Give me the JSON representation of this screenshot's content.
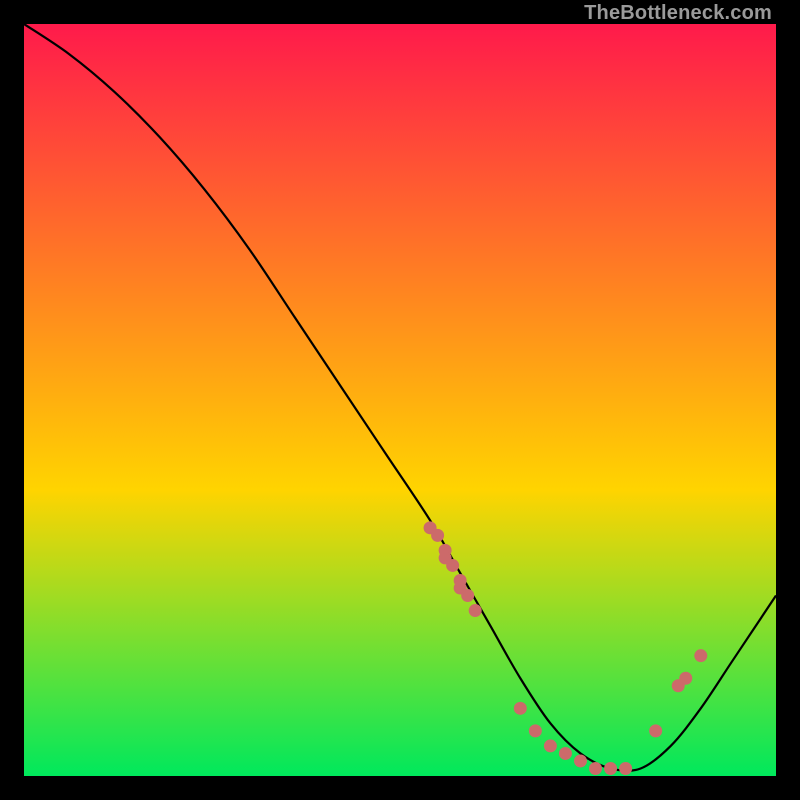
{
  "watermark": "TheBottleneck.com",
  "chart_data": {
    "type": "line",
    "title": "",
    "xlabel": "",
    "ylabel": "",
    "xlim": [
      0,
      100
    ],
    "ylim": [
      0,
      100
    ],
    "grid": false,
    "legend": false,
    "background_gradient": {
      "top": "#ff1a4b",
      "mid": "#ffd400",
      "bottom": "#00e85c"
    },
    "series": [
      {
        "name": "bottleneck-curve",
        "color": "#000000",
        "x": [
          0,
          6,
          12,
          18,
          24,
          30,
          36,
          42,
          48,
          54,
          58,
          62,
          66,
          70,
          74,
          78,
          82,
          86,
          90,
          94,
          98,
          100
        ],
        "y": [
          100,
          96,
          91,
          85,
          78,
          70,
          61,
          52,
          43,
          34,
          27,
          20,
          13,
          7,
          3,
          1,
          1,
          4,
          9,
          15,
          21,
          24
        ]
      }
    ],
    "scatter": {
      "name": "highlighted-points",
      "color": "#cc6a6a",
      "x": [
        54,
        55,
        56,
        56,
        57,
        58,
        58,
        59,
        60,
        66,
        68,
        70,
        72,
        74,
        76,
        78,
        80,
        84,
        87,
        88,
        90
      ],
      "y": [
        33,
        32,
        30,
        29,
        28,
        26,
        25,
        24,
        22,
        9,
        6,
        4,
        3,
        2,
        1,
        1,
        1,
        6,
        12,
        13,
        16
      ]
    }
  }
}
